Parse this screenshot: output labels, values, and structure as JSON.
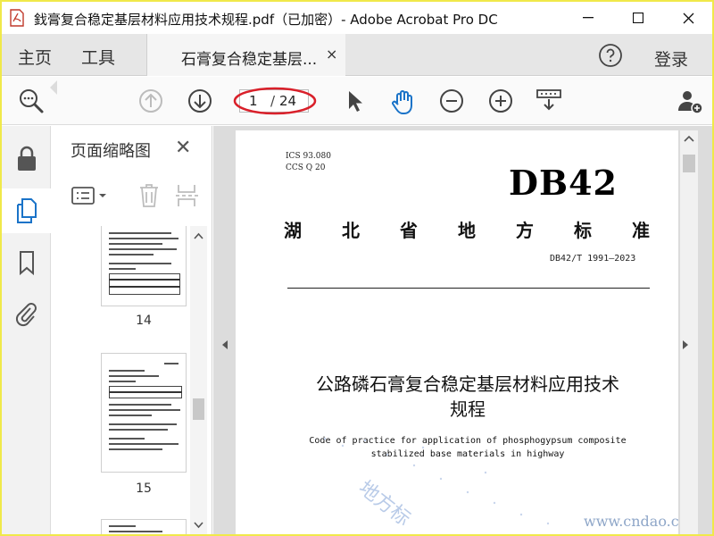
{
  "window": {
    "title": "鈛膏复合稳定基层材料应用技术规程.pdf（已加密）- Adobe Acrobat Pro DC"
  },
  "tabs": {
    "home": "主页",
    "tools": "工具",
    "doc_tab": "石膏复合稳定基层...",
    "doc_tab_close": "×",
    "login": "登录"
  },
  "toolbar": {
    "current_page": "1",
    "page_separator": "/",
    "total_pages": "24"
  },
  "thumbnails_panel": {
    "title": "页面缩略图",
    "close": "✕",
    "pages": [
      {
        "number": "14"
      },
      {
        "number": "15"
      }
    ]
  },
  "document": {
    "ics": "ICS 93.080",
    "ccs": "CCS Q 20",
    "code": "DB42",
    "province_chars": [
      "湖",
      "北",
      "省",
      "地",
      "方",
      "标",
      "准"
    ],
    "standard_number": "DB42/T 1991—2023",
    "title_cn_line1": "公路磷石膏复合稳定基层材料应用技术",
    "title_cn_line2": "规程",
    "title_en_line1": "Code of practice for application of phosphogypsum composite",
    "title_en_line2": "stabilized base materials in highway",
    "watermark_text": "地方标",
    "watermark_site": "www.cndao.com"
  },
  "colors": {
    "accent_blue": "#1a73c8",
    "annotation_red": "#d9202a",
    "frame_yellow": "#f0e94a"
  }
}
